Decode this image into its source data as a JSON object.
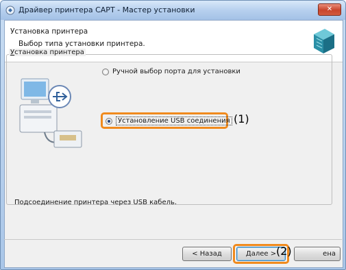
{
  "window": {
    "title": "Драйвер принтера CAPT - Мастер установки",
    "close_label": "✕"
  },
  "header": {
    "title": "Установка принтера",
    "subtitle": "Выбор типа установки принтера."
  },
  "group": {
    "legend_underlined": "У",
    "legend_rest": "становка принтера"
  },
  "options": {
    "manual_label": "Ручной выбор порта для установки",
    "manual_selected": false,
    "usb_label": "Установление USB соединения",
    "usb_selected": true
  },
  "info_text": "Подсоединение принтера через USB кабель.",
  "callouts": {
    "one": "(1)",
    "two": "(2)"
  },
  "buttons": {
    "back_label": "< Назад",
    "next_label": "Далее >",
    "cancel_label": "ена"
  },
  "colors": {
    "highlight": "#f08a1d",
    "title_bar": "#b7d0ee",
    "close_button": "#c9452c"
  },
  "icons": {
    "title": "printer-icon",
    "header_graphic": "printer-cube-icon",
    "illustration": "computer-usb-icon"
  }
}
